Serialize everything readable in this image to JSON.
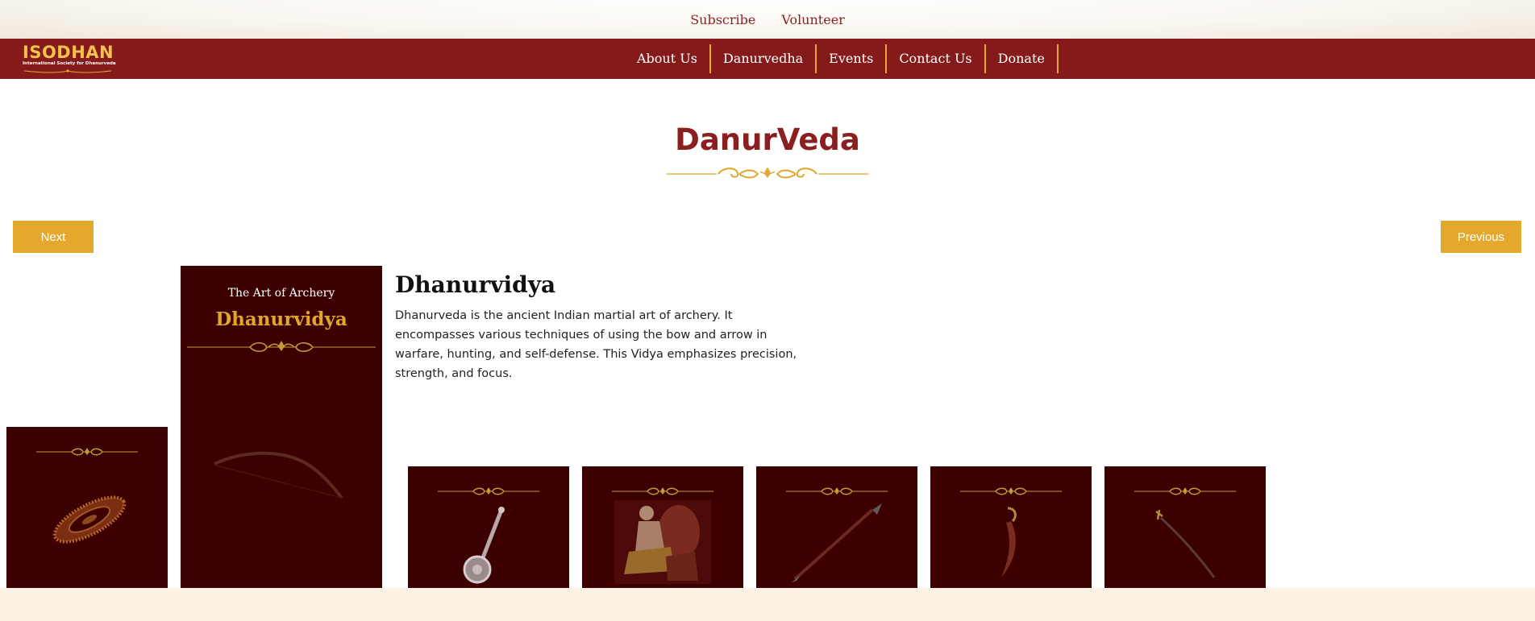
{
  "topbar": {
    "subscribe": "Subscribe",
    "volunteer": "Volunteer"
  },
  "brand": {
    "name": "ISODHAN",
    "tagline": "International Society for Dhanurveda"
  },
  "nav": {
    "items": [
      "About Us",
      "Danurvedha",
      "Events",
      "Contact Us",
      "Donate"
    ]
  },
  "page": {
    "title": "DanurVeda"
  },
  "carousel": {
    "next_label": "Next",
    "previous_label": "Previous"
  },
  "featured": {
    "subtitle": "The Art of Archery",
    "title": "Dhanurvidya",
    "heading": "Dhanurvidya",
    "description": "Dhanurveda is the ancient Indian martial art of archery. It encompasses various techniques of using the bow and arrow in warfare, hunting, and self-defense. This Vidya emphasizes precision, strength, and focus."
  },
  "thumbnails": [
    "chakram",
    "mace",
    "wrestling",
    "spear",
    "dagger",
    "sword"
  ],
  "colors": {
    "brand_maroon": "#841a19",
    "card_dark": "#3d0000",
    "accent_gold": "#e4a82c",
    "title_red": "#8b1e1e",
    "footer_cream": "#fdf0e4"
  }
}
